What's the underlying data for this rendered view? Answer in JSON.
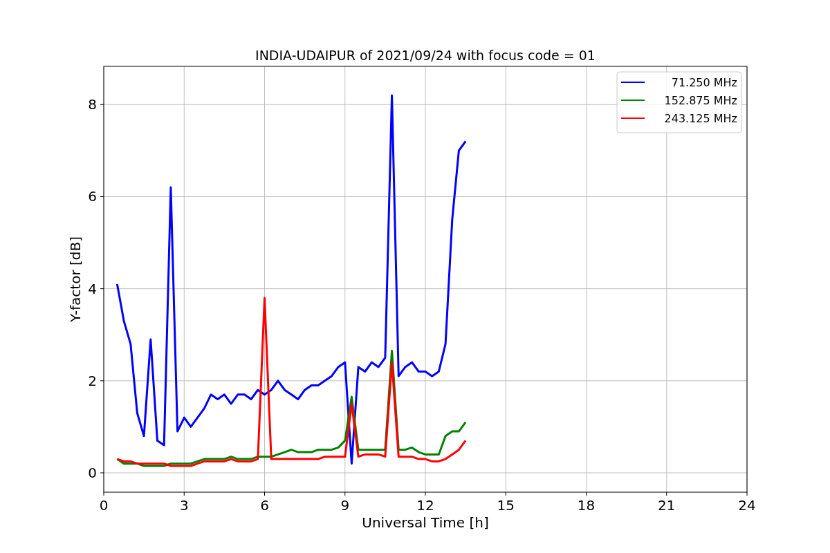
{
  "chart_data": {
    "type": "line",
    "title": "INDIA-UDAIPUR of 2021/09/24 with focus code = 01",
    "xlabel": "Universal Time [h]",
    "ylabel": "Y-factor [dB]",
    "x": [
      0.5,
      0.75,
      1,
      1.25,
      1.5,
      1.75,
      2,
      2.25,
      2.5,
      2.75,
      3,
      3.25,
      3.5,
      3.75,
      4,
      4.25,
      4.5,
      4.75,
      5,
      5.25,
      5.5,
      5.75,
      6,
      6.25,
      6.5,
      6.75,
      7,
      7.25,
      7.5,
      7.75,
      8,
      8.25,
      8.5,
      8.75,
      9,
      9.25,
      9.5,
      9.75,
      10,
      10.25,
      10.5,
      10.75,
      11,
      11.25,
      11.5,
      11.75,
      12,
      12.25,
      12.5,
      12.75,
      13,
      13.25,
      13.5
    ],
    "series": [
      {
        "name": " 71.250 MHz",
        "color": "#0000ff",
        "values": [
          4.1,
          3.3,
          2.8,
          1.3,
          0.8,
          2.9,
          0.7,
          0.6,
          6.2,
          0.9,
          1.2,
          1.0,
          1.2,
          1.4,
          1.7,
          1.6,
          1.7,
          1.5,
          1.7,
          1.7,
          1.6,
          1.8,
          1.7,
          1.8,
          2.0,
          1.8,
          1.7,
          1.6,
          1.8,
          1.9,
          1.9,
          2.0,
          2.1,
          2.3,
          2.4,
          0.2,
          2.3,
          2.2,
          2.4,
          2.3,
          2.5,
          8.2,
          2.1,
          2.3,
          2.4,
          2.2,
          2.2,
          2.1,
          2.2,
          2.8,
          5.5,
          7.0,
          7.2
        ]
      },
      {
        "name": "152.875 MHz",
        "color": "#008000",
        "values": [
          0.3,
          0.2,
          0.2,
          0.2,
          0.15,
          0.15,
          0.15,
          0.15,
          0.2,
          0.2,
          0.2,
          0.2,
          0.25,
          0.3,
          0.3,
          0.3,
          0.3,
          0.35,
          0.3,
          0.3,
          0.3,
          0.35,
          0.35,
          0.35,
          0.4,
          0.45,
          0.5,
          0.45,
          0.45,
          0.45,
          0.5,
          0.5,
          0.5,
          0.55,
          0.7,
          1.65,
          0.5,
          0.5,
          0.5,
          0.5,
          0.5,
          2.65,
          0.5,
          0.5,
          0.55,
          0.45,
          0.4,
          0.4,
          0.4,
          0.8,
          0.9,
          0.9,
          1.1
        ]
      },
      {
        "name": "243.125 MHz",
        "color": "#ff0000",
        "values": [
          0.3,
          0.25,
          0.25,
          0.2,
          0.2,
          0.2,
          0.2,
          0.2,
          0.15,
          0.15,
          0.15,
          0.15,
          0.2,
          0.25,
          0.25,
          0.25,
          0.25,
          0.3,
          0.25,
          0.25,
          0.25,
          0.3,
          3.8,
          0.3,
          0.3,
          0.3,
          0.3,
          0.3,
          0.3,
          0.3,
          0.3,
          0.35,
          0.35,
          0.35,
          0.35,
          1.5,
          0.35,
          0.4,
          0.4,
          0.4,
          0.35,
          2.4,
          0.35,
          0.35,
          0.35,
          0.3,
          0.3,
          0.25,
          0.25,
          0.3,
          0.4,
          0.5,
          0.7
        ]
      }
    ],
    "grid": true,
    "legend": true,
    "xlim": [
      0,
      24
    ],
    "ylim": [
      -0.42,
      8.83
    ],
    "xticks": [
      0,
      3,
      6,
      9,
      12,
      15,
      18,
      21,
      24
    ],
    "yticks": [
      0,
      2,
      4,
      6,
      8
    ]
  }
}
